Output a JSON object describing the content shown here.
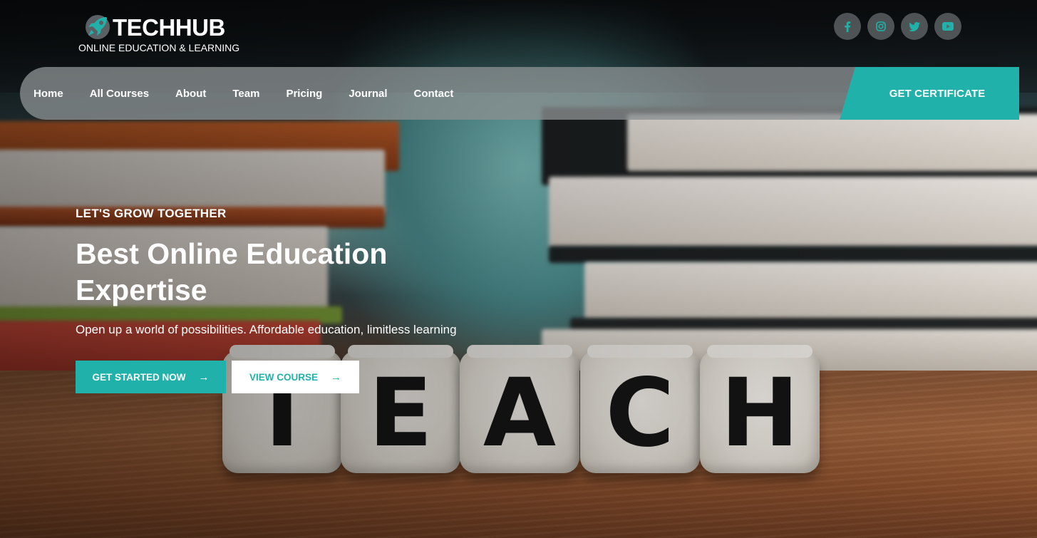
{
  "brand": {
    "name": "TECHHUB",
    "tagline": "ONLINE EDUCATION & LEARNING",
    "logo_icon": "rocket-icon",
    "accent_color": "#20b2aa"
  },
  "social": [
    {
      "icon": "facebook-icon"
    },
    {
      "icon": "instagram-icon"
    },
    {
      "icon": "twitter-icon"
    },
    {
      "icon": "youtube-icon"
    }
  ],
  "nav": {
    "items": [
      "Home",
      "All Courses",
      "About",
      "Team",
      "Pricing",
      "Journal",
      "Contact"
    ],
    "cta_label": "GET CERTIFICATE"
  },
  "hero": {
    "kicker": "LET'S GROW TOGETHER",
    "headline": "Best Online Education Expertise",
    "subtitle": "Open up a world of possibilities. Affordable education, limitless learning",
    "primary_button": "GET STARTED NOW",
    "secondary_button": "VIEW COURSE",
    "button_arrow": "→",
    "dice_letters": [
      "T",
      "E",
      "A",
      "C",
      "H"
    ]
  }
}
